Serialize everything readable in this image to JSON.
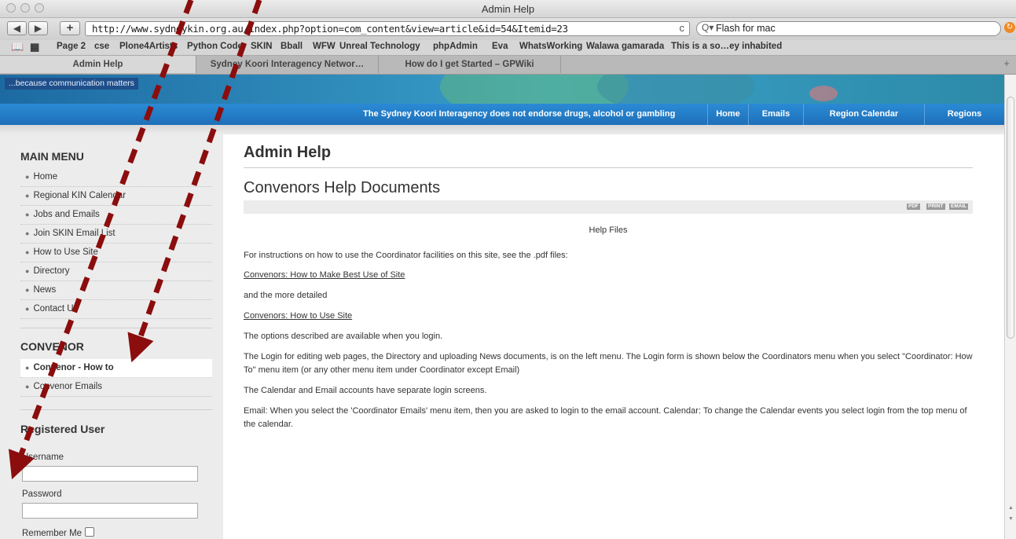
{
  "window": {
    "title": "Admin Help"
  },
  "toolbar": {
    "back": "◀",
    "forward": "▶",
    "add": "+",
    "url": "http://www.sydneykin.org.au/index.php?option=com_content&view=article&id=54&Itemid=23",
    "reload": "c",
    "search_value": "Flash for mac",
    "search_icon": "Q▾"
  },
  "bookmarks": {
    "items": [
      "Page 2",
      "cse",
      "Plone4Artists",
      "Python Code",
      "SKIN",
      "Bball",
      "WFW",
      "Unreal Technology",
      "phpAdmin",
      "Eva",
      "WhatsWorking",
      "Walawa gamarada",
      "This is a so…ey inhabited"
    ]
  },
  "tabs": [
    "Admin Help",
    "Sydney Koori Interagency Networ…",
    "How do I get Started – GPWiki"
  ],
  "site": {
    "tagline": "...because communication matters",
    "notice": "The Sydney Koori Interagency does not endorse drugs, alcohol or gambling",
    "nav": [
      "Home",
      "Emails",
      "Region Calendar",
      "Regions"
    ]
  },
  "sidebar": {
    "main_menu_heading": "MAIN MENU",
    "main_menu": [
      "Home",
      "Regional KIN Calendar",
      "Jobs and Emails",
      "Join SKIN Email List",
      "How to Use Site",
      "Directory",
      "News",
      "Contact Us"
    ],
    "convenor_heading": "CONVENOR",
    "convenor_menu": [
      "Convenor - How to",
      "Convenor Emails"
    ],
    "registered_heading": "Registered User",
    "username_label": "Username",
    "password_label": "Password",
    "remember_label": "Remember Me"
  },
  "content": {
    "page_title": "Admin Help",
    "article_title": "Convenors Help Documents",
    "icons": [
      "PDF",
      "PRINT",
      "EMAIL"
    ],
    "help_files": "Help Files",
    "p1": "For instructions on how to use the Coordinator facilities on this site, see the .pdf files:",
    "link1": "Convenors: How to Make Best Use of Site",
    "p2": "and the more detailed",
    "link2": "Convenors: How to Use Site",
    "p3": "The options described are available when you login.",
    "p4": "The Login for editing web pages, the Directory and uploading News documents, is on the left menu. The Login form is shown below the Coordinators menu when you select \"Coordinator: How To\" menu item (or any other menu item under Coordinator except Email)",
    "p5": "The Calendar and Email accounts have separate login screens.",
    "p6": "Email: When you select the 'Coordinator Emails' menu item, then you are asked to login to the email account. Calendar: To change the Calendar events you select login from the top menu of the calendar."
  },
  "colors": {
    "nav_blue": "#1e6fb8",
    "overlay_arrow": "#8b0d0d"
  }
}
